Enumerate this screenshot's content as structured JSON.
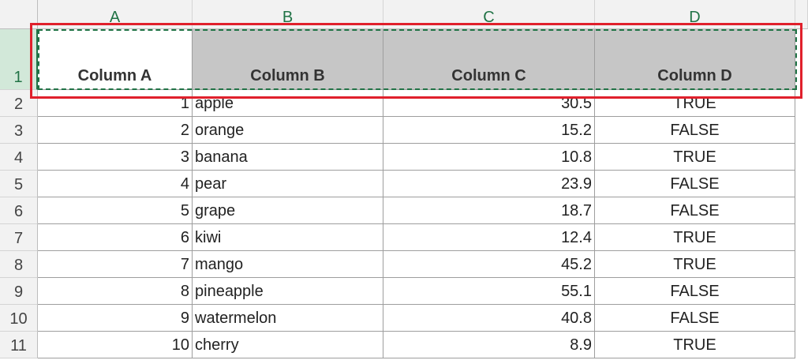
{
  "sheet": {
    "column_headers": [
      "A",
      "B",
      "C",
      "D"
    ],
    "row_numbers": [
      "1",
      "2",
      "3",
      "4",
      "5",
      "6",
      "7",
      "8",
      "9",
      "10",
      "11"
    ],
    "header_row": [
      "Column A",
      "Column B",
      "Column C",
      "Column D"
    ],
    "rows": [
      [
        "1",
        "apple",
        "30.5",
        "TRUE"
      ],
      [
        "2",
        "orange",
        "15.2",
        "FALSE"
      ],
      [
        "3",
        "banana",
        "10.8",
        "TRUE"
      ],
      [
        "4",
        "pear",
        "23.9",
        "FALSE"
      ],
      [
        "5",
        "grape",
        "18.7",
        "FALSE"
      ],
      [
        "6",
        "kiwi",
        "12.4",
        "TRUE"
      ],
      [
        "7",
        "mango",
        "45.2",
        "TRUE"
      ],
      [
        "8",
        "pineapple",
        "55.1",
        "FALSE"
      ],
      [
        "9",
        "watermelon",
        "40.8",
        "FALSE"
      ],
      [
        "10",
        "cherry",
        "8.9",
        "TRUE"
      ]
    ],
    "selected_row": "1"
  },
  "colors": {
    "accent": "#217346",
    "highlight": "#e0202c",
    "header_fill": "#c6c6c6"
  }
}
